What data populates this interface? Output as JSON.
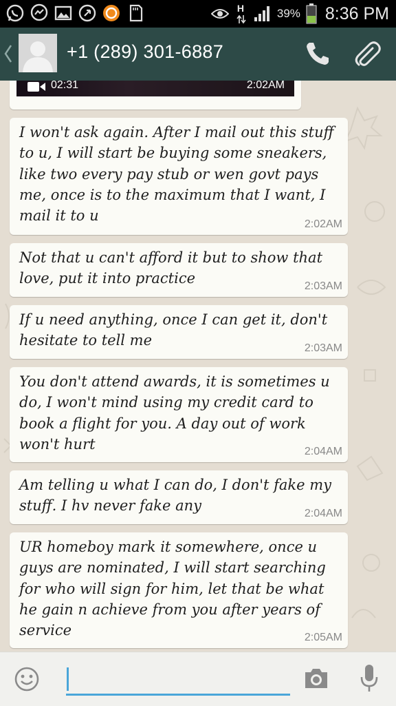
{
  "status_bar": {
    "icons": [
      "whatsapp-icon",
      "messenger-icon",
      "gallery-icon",
      "sync-icon",
      "orange-app-icon",
      "sd-card-icon",
      "eye-icon",
      "data-arrows-icon",
      "signal-icon",
      "battery-icon"
    ],
    "network_type": "H",
    "battery_percent": "39%",
    "time": "8:36 PM",
    "battery_color": "#8bc34a"
  },
  "header": {
    "back_icon": "chevron-left-icon",
    "contact_name": "+1 (289) 301-6887",
    "call_icon": "phone-icon",
    "attach_icon": "paperclip-icon",
    "background_color": "#2d4a47"
  },
  "chat": {
    "video_message": {
      "duration": "02:31",
      "time": "2:02AM"
    },
    "messages": [
      {
        "text": "I won't ask again. After I mail out this stuff to u, I will start be buying some sneakers, like two every pay stub or wen govt pays me, once is to the maximum that I want, I mail it to u",
        "time": "2:02AM"
      },
      {
        "text": "Not that u can't afford it but to show that love, put it into practice",
        "time": "2:03AM"
      },
      {
        "text": "If u need anything, once I can get it, don't hesitate to tell me",
        "time": "2:03AM"
      },
      {
        "text": "You don't attend awards, it is sometimes u do, I won't mind using my credit card to book a flight for you. A day out of work won't hurt",
        "time": "2:04AM"
      },
      {
        "text": "Am telling u what I can do, I don't fake my stuff. I hv never fake any",
        "time": "2:04AM"
      },
      {
        "text": "UR homeboy mark it somewhere, once u guys are nominated, I will start searching for who will sign for him, let that be what he gain n achieve from you after years of service",
        "time": "2:05AM"
      }
    ]
  },
  "input_bar": {
    "emoji_icon": "smiley-icon",
    "text_value": "",
    "placeholder": "",
    "camera_icon": "camera-icon",
    "mic_icon": "microphone-icon",
    "accent_color": "#4aa6d9"
  }
}
